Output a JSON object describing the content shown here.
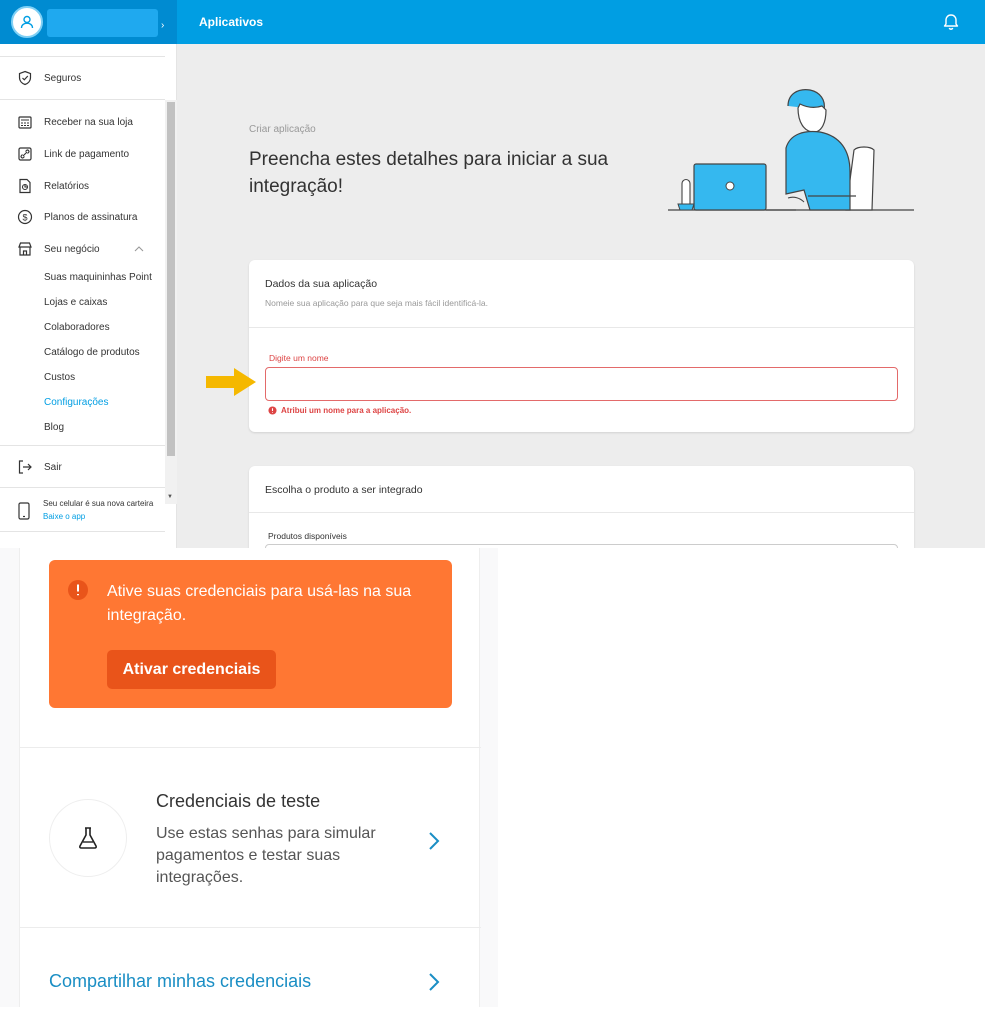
{
  "header": {
    "title": "Aplicativos",
    "colors": {
      "primary": "#009ee3",
      "primary_dark": "#008bd1"
    }
  },
  "sidebar": {
    "items": [
      {
        "label": "Seguros",
        "icon": "shield-icon"
      },
      {
        "label": "Receber na sua loja",
        "icon": "register-icon"
      },
      {
        "label": "Link de pagamento",
        "icon": "link-icon"
      },
      {
        "label": "Relatórios",
        "icon": "report-icon"
      },
      {
        "label": "Planos de assinatura",
        "icon": "dollar-circle-icon"
      },
      {
        "label": "Seu negócio",
        "icon": "store-icon"
      }
    ],
    "sub_items": [
      {
        "label": "Suas maquininhas Point"
      },
      {
        "label": "Lojas e caixas"
      },
      {
        "label": "Colaboradores"
      },
      {
        "label": "Catálogo de produtos"
      },
      {
        "label": "Custos"
      },
      {
        "label": "Configurações",
        "active": true,
        "color": "#009ee3"
      },
      {
        "label": "Blog"
      }
    ],
    "logout": "Sair",
    "promo": {
      "text": "Seu celular é sua nova carteira",
      "link": "Baixe o app"
    }
  },
  "main": {
    "breadcrumb": "Criar aplicação",
    "title": "Preencha estes detalhes para iniciar a sua integração!",
    "card1": {
      "title": "Dados da sua aplicação",
      "subtitle": "Nomeie sua aplicação para que seja mais fácil identificá-la.",
      "field_label": "Digite um nome",
      "field_value": "",
      "error": "Atribui um nome para a aplicação.",
      "error_color": "#dd4444"
    },
    "card2": {
      "title": "Escolha o produto a ser integrado",
      "field_label": "Produtos disponíveis"
    }
  },
  "annotation": {
    "arrow_color": "#f5b800"
  },
  "credentials_panel": {
    "alert": {
      "text": "Ative suas credenciais para usá-las na sua integração.",
      "button": "Ativar credenciais",
      "bg_color": "#ff7733"
    },
    "test": {
      "title": "Credenciais de teste",
      "description": "Use estas senhas para simular pagamentos e testar suas integrações.",
      "icon": "flask-icon"
    },
    "share_link": "Compartilhar minhas credenciais"
  }
}
